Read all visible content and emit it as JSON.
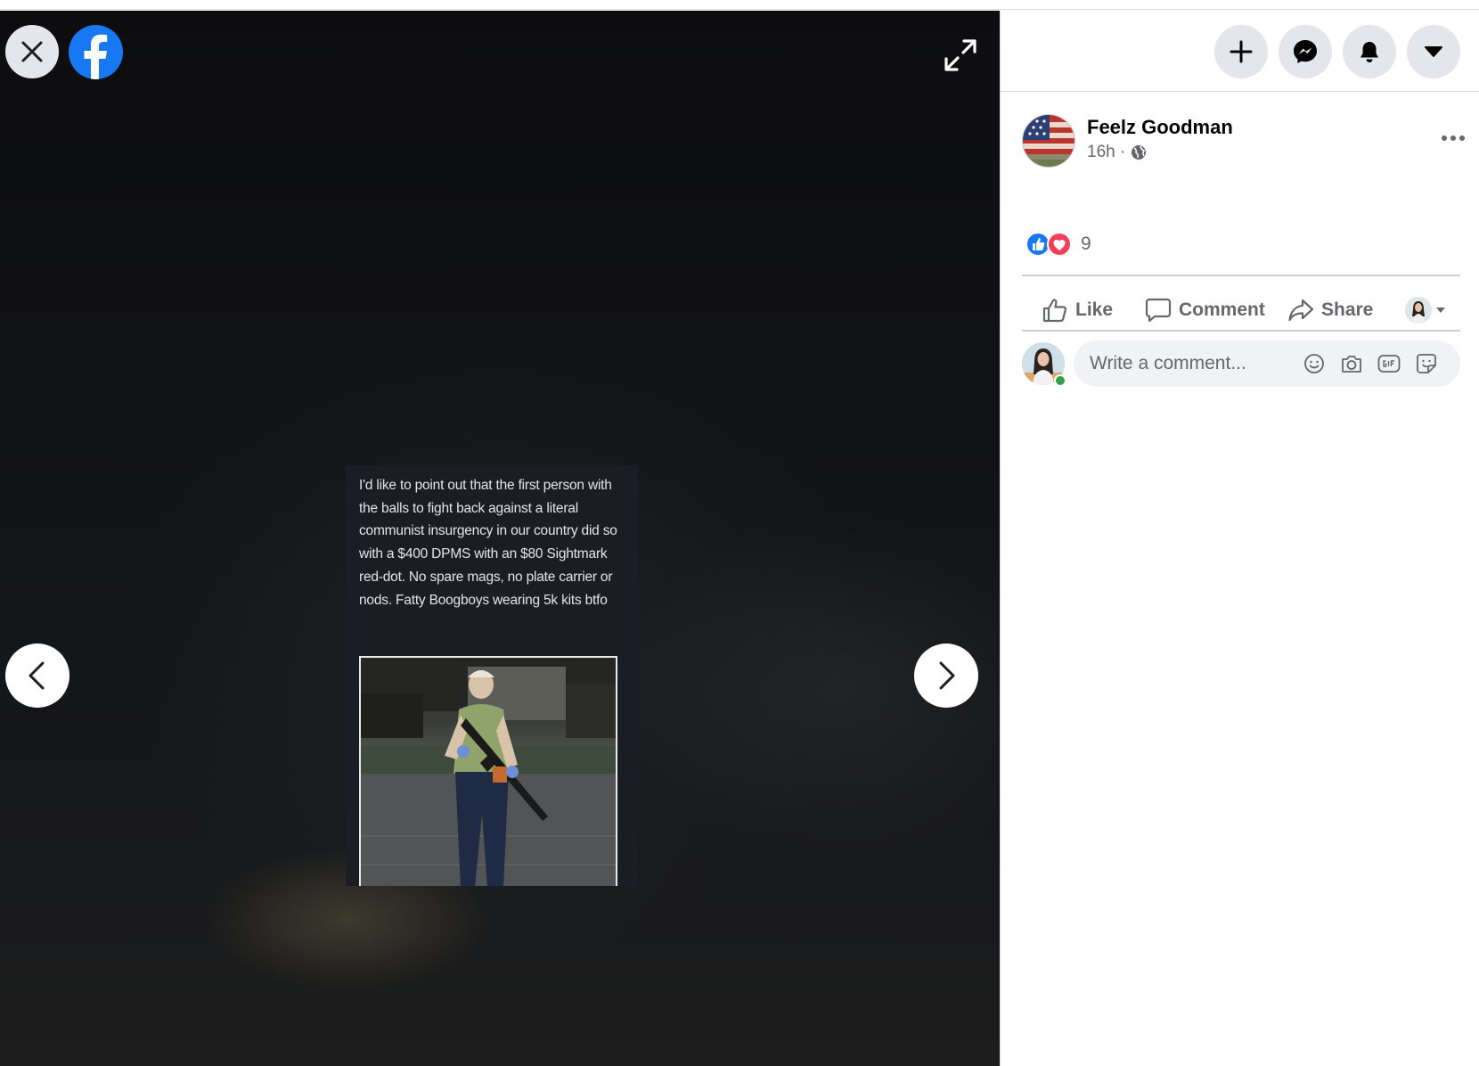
{
  "viewer": {
    "close_icon": "close-icon",
    "logo_icon": "facebook-logo-icon",
    "expand_icon": "expand-icon",
    "prev_icon": "chevron-left-icon",
    "next_icon": "chevron-right-icon",
    "photo": {
      "caption": "I'd like to point out that the first person with the balls to fight back against a literal communist insurgency in our country did so with a $400 DPMS with an $80 Sightmark red-dot. No spare mags, no plate carrier or nods. Fatty Boogboys wearing 5k kits btfo"
    }
  },
  "topnav": {
    "items": [
      {
        "name": "create",
        "icon": "plus-icon"
      },
      {
        "name": "messenger",
        "icon": "messenger-icon"
      },
      {
        "name": "notifications",
        "icon": "bell-icon"
      },
      {
        "name": "account",
        "icon": "caret-down-icon"
      }
    ]
  },
  "post": {
    "author": "Feelz Goodman",
    "time": "16h ·",
    "privacy_icon": "globe-icon",
    "more_icon": "more-dots-icon",
    "reactions": {
      "types": [
        "like",
        "love"
      ],
      "count": "9"
    },
    "actions": {
      "like": "Like",
      "comment": "Comment",
      "share": "Share"
    }
  },
  "comment": {
    "placeholder": "Write a comment...",
    "icons": [
      "emoji-icon",
      "camera-icon",
      "gif-icon",
      "sticker-icon"
    ]
  },
  "colors": {
    "brand": "#1877f2",
    "love": "#f33e58",
    "online": "#31a24c",
    "secondary_text": "#65676b",
    "button_bg": "#e4e6eb"
  }
}
